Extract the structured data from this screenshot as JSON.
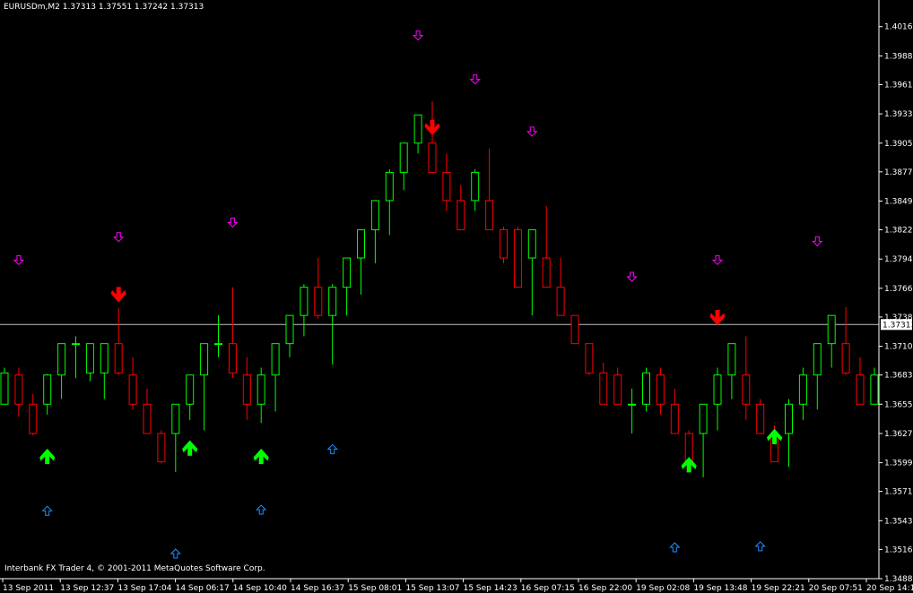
{
  "header": {
    "symbol": "EURUSDm,M2",
    "ohlc": "1.37313 1.37551 1.37242 1.37313"
  },
  "footer": {
    "text": "Interbank FX Trader 4, © 2001-2011 MetaQuotes Software Corp."
  },
  "colors": {
    "background": "#000000",
    "axis": "#ffffff",
    "bull": "#00ff00",
    "bear": "#ff0000",
    "price_line": "#c0c0c0",
    "magenta_arrow": "#ff00ff",
    "blue_arrow": "#1e90ff"
  },
  "chart_data": {
    "type": "candlestick",
    "price_line": 1.37313,
    "price_label": "1.37313",
    "ylim": [
      1.3488,
      1.403
    ],
    "y_ticks": [
      "1.40165",
      "1.39885",
      "1.39610",
      "1.39330",
      "1.39050",
      "1.38775",
      "1.38495",
      "1.38220",
      "1.37940",
      "1.37660",
      "1.37385",
      "1.37105",
      "1.36830",
      "1.36550",
      "1.36270",
      "1.35990",
      "1.35715",
      "1.35435",
      "1.35160",
      "1.34880"
    ],
    "x_ticks": [
      "13 Sep 2011",
      "13 Sep 12:37",
      "13 Sep 17:04",
      "14 Sep 06:17",
      "14 Sep 10:40",
      "14 Sep 16:37",
      "15 Sep 08:01",
      "15 Sep 13:07",
      "15 Sep 14:23",
      "16 Sep 07:15",
      "16 Sep 22:00",
      "19 Sep 02:08",
      "19 Sep 13:48",
      "19 Sep 22:21",
      "20 Sep 07:51",
      "20 Sep 14:10"
    ],
    "candles": [
      {
        "o": 1.3655,
        "h": 1.369,
        "l": 1.3655,
        "c": 1.3685
      },
      {
        "o": 1.3683,
        "h": 1.369,
        "l": 1.3643,
        "c": 1.3655
      },
      {
        "o": 1.3655,
        "h": 1.3665,
        "l": 1.3625,
        "c": 1.3627
      },
      {
        "o": 1.3655,
        "h": 1.3684,
        "l": 1.3645,
        "c": 1.3683
      },
      {
        "o": 1.3683,
        "h": 1.3713,
        "l": 1.366,
        "c": 1.3713
      },
      {
        "o": 1.3713,
        "h": 1.372,
        "l": 1.368,
        "c": 1.3713
      },
      {
        "o": 1.3685,
        "h": 1.37,
        "l": 1.3677,
        "c": 1.3713
      },
      {
        "o": 1.3685,
        "h": 1.3713,
        "l": 1.366,
        "c": 1.3713
      },
      {
        "o": 1.3713,
        "h": 1.3747,
        "l": 1.3683,
        "c": 1.3685
      },
      {
        "o": 1.3683,
        "h": 1.37,
        "l": 1.365,
        "c": 1.3655
      },
      {
        "o": 1.3655,
        "h": 1.367,
        "l": 1.3627,
        "c": 1.3627
      },
      {
        "o": 1.3627,
        "h": 1.363,
        "l": 1.3598,
        "c": 1.36
      },
      {
        "o": 1.3627,
        "h": 1.3655,
        "l": 1.359,
        "c": 1.3655
      },
      {
        "o": 1.3655,
        "h": 1.3683,
        "l": 1.364,
        "c": 1.3683
      },
      {
        "o": 1.3683,
        "h": 1.37,
        "l": 1.363,
        "c": 1.3713
      },
      {
        "o": 1.3713,
        "h": 1.374,
        "l": 1.37,
        "c": 1.3713
      },
      {
        "o": 1.3713,
        "h": 1.3767,
        "l": 1.368,
        "c": 1.3685
      },
      {
        "o": 1.3683,
        "h": 1.37,
        "l": 1.364,
        "c": 1.3655
      },
      {
        "o": 1.3655,
        "h": 1.369,
        "l": 1.3637,
        "c": 1.3683
      },
      {
        "o": 1.3683,
        "h": 1.3713,
        "l": 1.3648,
        "c": 1.3713
      },
      {
        "o": 1.3713,
        "h": 1.374,
        "l": 1.37,
        "c": 1.374
      },
      {
        "o": 1.374,
        "h": 1.377,
        "l": 1.372,
        "c": 1.3767
      },
      {
        "o": 1.3767,
        "h": 1.3795,
        "l": 1.3737,
        "c": 1.374
      },
      {
        "o": 1.374,
        "h": 1.377,
        "l": 1.3693,
        "c": 1.3767
      },
      {
        "o": 1.3767,
        "h": 1.3795,
        "l": 1.374,
        "c": 1.3795
      },
      {
        "o": 1.3795,
        "h": 1.3822,
        "l": 1.376,
        "c": 1.3822
      },
      {
        "o": 1.3822,
        "h": 1.385,
        "l": 1.379,
        "c": 1.385
      },
      {
        "o": 1.385,
        "h": 1.388,
        "l": 1.3817,
        "c": 1.3877
      },
      {
        "o": 1.3877,
        "h": 1.3903,
        "l": 1.386,
        "c": 1.3905
      },
      {
        "o": 1.3905,
        "h": 1.3932,
        "l": 1.3895,
        "c": 1.3932
      },
      {
        "o": 1.3905,
        "h": 1.3945,
        "l": 1.389,
        "c": 1.3877
      },
      {
        "o": 1.3877,
        "h": 1.3895,
        "l": 1.384,
        "c": 1.385
      },
      {
        "o": 1.385,
        "h": 1.3865,
        "l": 1.3822,
        "c": 1.3822
      },
      {
        "o": 1.385,
        "h": 1.388,
        "l": 1.384,
        "c": 1.3877
      },
      {
        "o": 1.385,
        "h": 1.39,
        "l": 1.3822,
        "c": 1.3822
      },
      {
        "o": 1.3822,
        "h": 1.3825,
        "l": 1.379,
        "c": 1.3795
      },
      {
        "o": 1.3822,
        "h": 1.3825,
        "l": 1.3767,
        "c": 1.3767
      },
      {
        "o": 1.3795,
        "h": 1.3822,
        "l": 1.374,
        "c": 1.3822
      },
      {
        "o": 1.3795,
        "h": 1.3845,
        "l": 1.3767,
        "c": 1.3767
      },
      {
        "o": 1.3767,
        "h": 1.3795,
        "l": 1.374,
        "c": 1.374
      },
      {
        "o": 1.374,
        "h": 1.374,
        "l": 1.3713,
        "c": 1.3713
      },
      {
        "o": 1.3713,
        "h": 1.3713,
        "l": 1.3683,
        "c": 1.3685
      },
      {
        "o": 1.3685,
        "h": 1.3695,
        "l": 1.3655,
        "c": 1.3655
      },
      {
        "o": 1.3683,
        "h": 1.369,
        "l": 1.3655,
        "c": 1.3655
      },
      {
        "o": 1.3655,
        "h": 1.367,
        "l": 1.3627,
        "c": 1.3655
      },
      {
        "o": 1.3655,
        "h": 1.369,
        "l": 1.3648,
        "c": 1.3685
      },
      {
        "o": 1.3683,
        "h": 1.369,
        "l": 1.3645,
        "c": 1.3655
      },
      {
        "o": 1.3655,
        "h": 1.367,
        "l": 1.3627,
        "c": 1.3627
      },
      {
        "o": 1.3627,
        "h": 1.363,
        "l": 1.36,
        "c": 1.36
      },
      {
        "o": 1.3627,
        "h": 1.364,
        "l": 1.3585,
        "c": 1.3655
      },
      {
        "o": 1.3655,
        "h": 1.369,
        "l": 1.363,
        "c": 1.3683
      },
      {
        "o": 1.3683,
        "h": 1.3713,
        "l": 1.366,
        "c": 1.3713
      },
      {
        "o": 1.3683,
        "h": 1.372,
        "l": 1.364,
        "c": 1.3655
      },
      {
        "o": 1.3655,
        "h": 1.366,
        "l": 1.3627,
        "c": 1.3627
      },
      {
        "o": 1.3627,
        "h": 1.3635,
        "l": 1.36,
        "c": 1.36
      },
      {
        "o": 1.3627,
        "h": 1.366,
        "l": 1.3595,
        "c": 1.3655
      },
      {
        "o": 1.3655,
        "h": 1.369,
        "l": 1.364,
        "c": 1.3683
      },
      {
        "o": 1.3683,
        "h": 1.3713,
        "l": 1.365,
        "c": 1.3713
      },
      {
        "o": 1.3713,
        "h": 1.374,
        "l": 1.369,
        "c": 1.374
      },
      {
        "o": 1.3713,
        "h": 1.3748,
        "l": 1.3683,
        "c": 1.3685
      },
      {
        "o": 1.3683,
        "h": 1.37,
        "l": 1.3655,
        "c": 1.3655
      },
      {
        "o": 1.3655,
        "h": 1.369,
        "l": 1.3655,
        "c": 1.3683
      },
      {
        "o": 1.3683,
        "h": 1.3713,
        "l": 1.3655,
        "c": 1.3655
      }
    ],
    "markers": [
      {
        "idx": 1,
        "kind": "hollow-down",
        "price": 1.3793
      },
      {
        "idx": 8,
        "kind": "hollow-down",
        "price": 1.3815
      },
      {
        "idx": 16,
        "kind": "hollow-down",
        "price": 1.3829
      },
      {
        "idx": 29,
        "kind": "hollow-down",
        "price": 1.4008
      },
      {
        "idx": 33,
        "kind": "hollow-down",
        "price": 1.3966
      },
      {
        "idx": 37,
        "kind": "hollow-down",
        "price": 1.3916
      },
      {
        "idx": 44,
        "kind": "hollow-down",
        "price": 1.3777
      },
      {
        "idx": 50,
        "kind": "hollow-down",
        "price": 1.3793
      },
      {
        "idx": 57,
        "kind": "hollow-down",
        "price": 1.3811
      },
      {
        "idx": 8,
        "kind": "solid-down",
        "price": 1.376
      },
      {
        "idx": 30,
        "kind": "solid-down",
        "price": 1.392
      },
      {
        "idx": 50,
        "kind": "solid-down",
        "price": 1.3738
      },
      {
        "idx": 3,
        "kind": "solid-up",
        "price": 1.3605
      },
      {
        "idx": 13,
        "kind": "solid-up",
        "price": 1.3613
      },
      {
        "idx": 18,
        "kind": "solid-up",
        "price": 1.3605
      },
      {
        "idx": 48,
        "kind": "solid-up",
        "price": 1.3597
      },
      {
        "idx": 54,
        "kind": "solid-up",
        "price": 1.3624
      },
      {
        "idx": 3,
        "kind": "hollow-up",
        "price": 1.3553
      },
      {
        "idx": 12,
        "kind": "hollow-up",
        "price": 1.3512
      },
      {
        "idx": 18,
        "kind": "hollow-up",
        "price": 1.3554
      },
      {
        "idx": 23,
        "kind": "hollow-up",
        "price": 1.3612
      },
      {
        "idx": 47,
        "kind": "hollow-up",
        "price": 1.3518
      },
      {
        "idx": 53,
        "kind": "hollow-up",
        "price": 1.3519
      }
    ]
  }
}
